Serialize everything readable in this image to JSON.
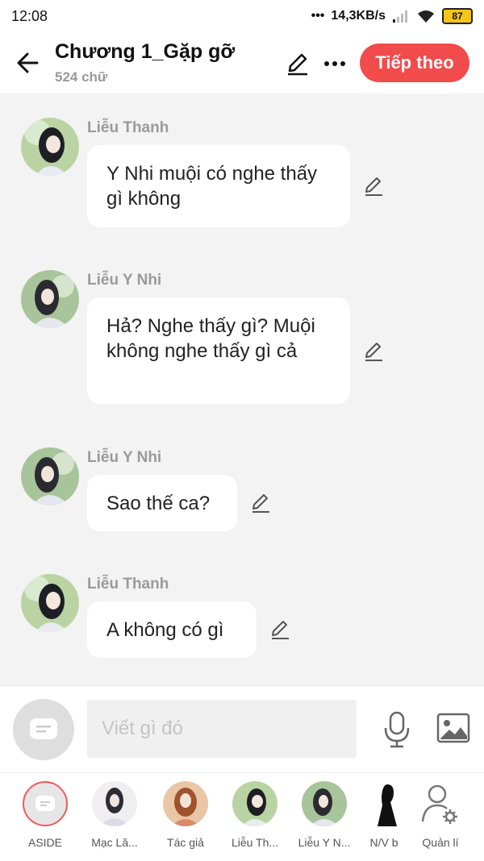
{
  "status": {
    "time": "12:08",
    "network_speed": "14,3KB/s",
    "battery": "87"
  },
  "header": {
    "title": "Chương 1_Gặp gỡ",
    "subtitle": "524 chữ",
    "next_label": "Tiếp theo",
    "icons": {
      "back": "arrow-left-icon",
      "edit": "pencil-icon",
      "more": "more-dots-icon"
    },
    "accent_color": "#f24b4b"
  },
  "messages": [
    {
      "sender": "Liễu Thanh",
      "text": "Y Nhi muội có nghe thấy gì không"
    },
    {
      "sender": "Liễu Y Nhi",
      "text": "Hả? Nghe thấy gì? Muội không nghe thấy gì cả"
    },
    {
      "sender": "Liễu Y Nhi",
      "text": "Sao thế ca?"
    },
    {
      "sender": "Liễu Thanh",
      "text": "A không có gì"
    }
  ],
  "composer": {
    "placeholder": "Viết gì đó",
    "icons": {
      "aside": "chat-bubble-icon",
      "mic": "microphone-icon",
      "image": "image-icon"
    }
  },
  "characters": [
    {
      "label": "ASIDE"
    },
    {
      "label": "Mạc Lă..."
    },
    {
      "label": "Tác giả"
    },
    {
      "label": "Liễu Th..."
    },
    {
      "label": "Liễu Y N..."
    },
    {
      "label": "N/V b"
    },
    {
      "label": "Quản lí"
    }
  ]
}
